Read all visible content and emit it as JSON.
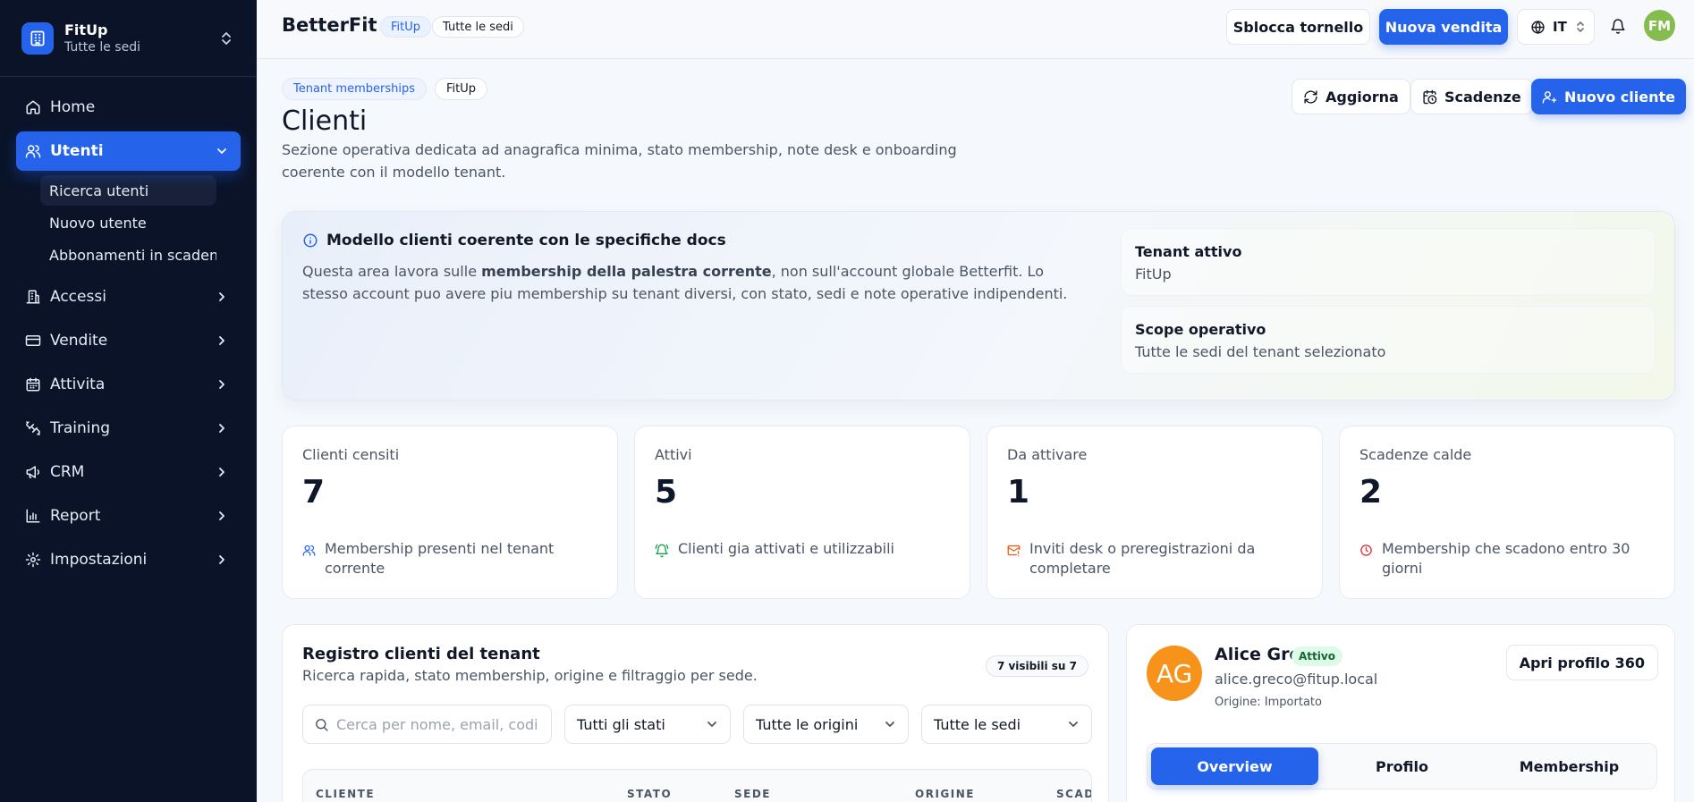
{
  "sidebar": {
    "brand_name": "FitUp",
    "brand_sub": "Tutte le sedi",
    "nav": {
      "home": "Home",
      "utenti": "Utenti",
      "ricerca": "Ricerca utenti",
      "nuovo": "Nuovo utente",
      "abbonamenti": "Abbonamenti in scadenza",
      "accessi": "Accessi",
      "vendite": "Vendite",
      "attivita": "Attivita",
      "training": "Training",
      "crm": "CRM",
      "report": "Report",
      "impostazioni": "Impostazioni"
    }
  },
  "topbar": {
    "app_name": "BetterFit",
    "tenant_pill": "FitUp",
    "scope_pill": "Tutte le sedi",
    "unlock_label": "Sblocca tornello",
    "new_sale_label": "Nuova vendita",
    "lang": "IT",
    "avatar_initials": "FM"
  },
  "header": {
    "crumb1": "Tenant memberships",
    "crumb2": "FitUp",
    "title": "Clienti",
    "description": "Sezione operativa dedicata ad anagrafica minima, stato membership, note desk e onboarding coerente con il modello tenant.",
    "refresh_label": "Aggiorna",
    "deadlines_label": "Scadenze",
    "new_client_label": "Nuovo cliente"
  },
  "info": {
    "title": "Modello clienti coerente con le specifiche docs",
    "text_before": "Questa area lavora sulle ",
    "text_bold": "membership della palestra corrente",
    "text_after": ", non sull'account globale Betterfit. Lo stesso account puo avere piu membership su tenant diversi, con stato, sedi e note operative indipendenti.",
    "tenant_label": "Tenant attivo",
    "tenant_value": "FitUp",
    "scope_label": "Scope operativo",
    "scope_value": "Tutte le sedi del tenant selezionato"
  },
  "stats": [
    {
      "label": "Clienti censiti",
      "value": "7",
      "foot": "Membership presenti nel tenant corrente",
      "icon": "users-icon",
      "color": "#2563eb"
    },
    {
      "label": "Attivi",
      "value": "5",
      "foot": "Clienti gia attivati e utilizzabili",
      "icon": "bell-ring-icon",
      "color": "#16a34a"
    },
    {
      "label": "Da attivare",
      "value": "1",
      "foot": "Inviti desk o preregistrazioni da completare",
      "icon": "mail-warning-icon",
      "color": "#ea580c"
    },
    {
      "label": "Scadenze calde",
      "value": "2",
      "foot": "Membership che scadono entro 30 giorni",
      "icon": "clock-icon",
      "color": "#dc2626"
    }
  ],
  "registry": {
    "title": "Registro clienti del tenant",
    "subtitle": "Ricerca rapida, stato membership, origine e filtraggio per sede.",
    "count": "7 visibili su 7",
    "search_placeholder": "Cerca per nome, email, codice",
    "filter_status": "Tutti gli stati",
    "filter_origin": "Tutte le origini",
    "filter_site": "Tutte le sedi",
    "columns": [
      "CLIENTE",
      "STATO",
      "SEDE",
      "ORIGINE",
      "SCADENZA"
    ]
  },
  "detail": {
    "initials": "AG",
    "name": "Alice Greco",
    "status": "Attivo",
    "email": "alice.greco@fitup.local",
    "origin": "Origine: Importato",
    "open_label": "Apri profilo 360",
    "tabs": [
      "Overview",
      "Profilo",
      "Membership"
    ]
  },
  "colors": {
    "sidebar_bg": "#0a1328",
    "accent": "#2563eb",
    "avatar_top": "#84bc4e",
    "avatar_detail": "#f7931a",
    "status_active_bg": "#dcfce7"
  }
}
